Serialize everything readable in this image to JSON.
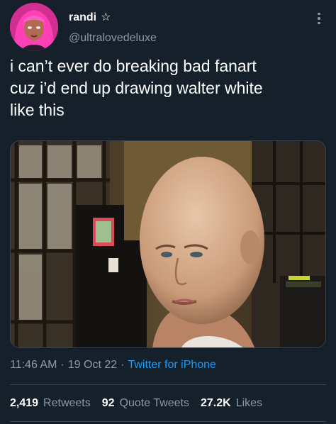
{
  "author": {
    "display_name": "randi",
    "badge_icon": "star-outline-icon",
    "handle": "@ultralovedeluxe",
    "avatar_icon": "avatar-pink-hair"
  },
  "tweet": {
    "text": "i can’t ever do breaking bad fanart\ncuz i’d end up drawing walter white\nlike this"
  },
  "media": {
    "icon": "photo-bald-person"
  },
  "meta": {
    "time": "11:46 AM",
    "sep1": "·",
    "date": "19 Oct 22",
    "sep2": "·",
    "source": "Twitter for iPhone"
  },
  "stats": {
    "retweets_count": "2,419",
    "retweets_label": "Retweets",
    "quotes_count": "92",
    "quotes_label": "Quote Tweets",
    "likes_count": "27.2K",
    "likes_label": "Likes"
  },
  "colors": {
    "background": "#15202b",
    "secondary_text": "#8899a6",
    "link": "#1d9bf0",
    "divider": "#38444d"
  }
}
